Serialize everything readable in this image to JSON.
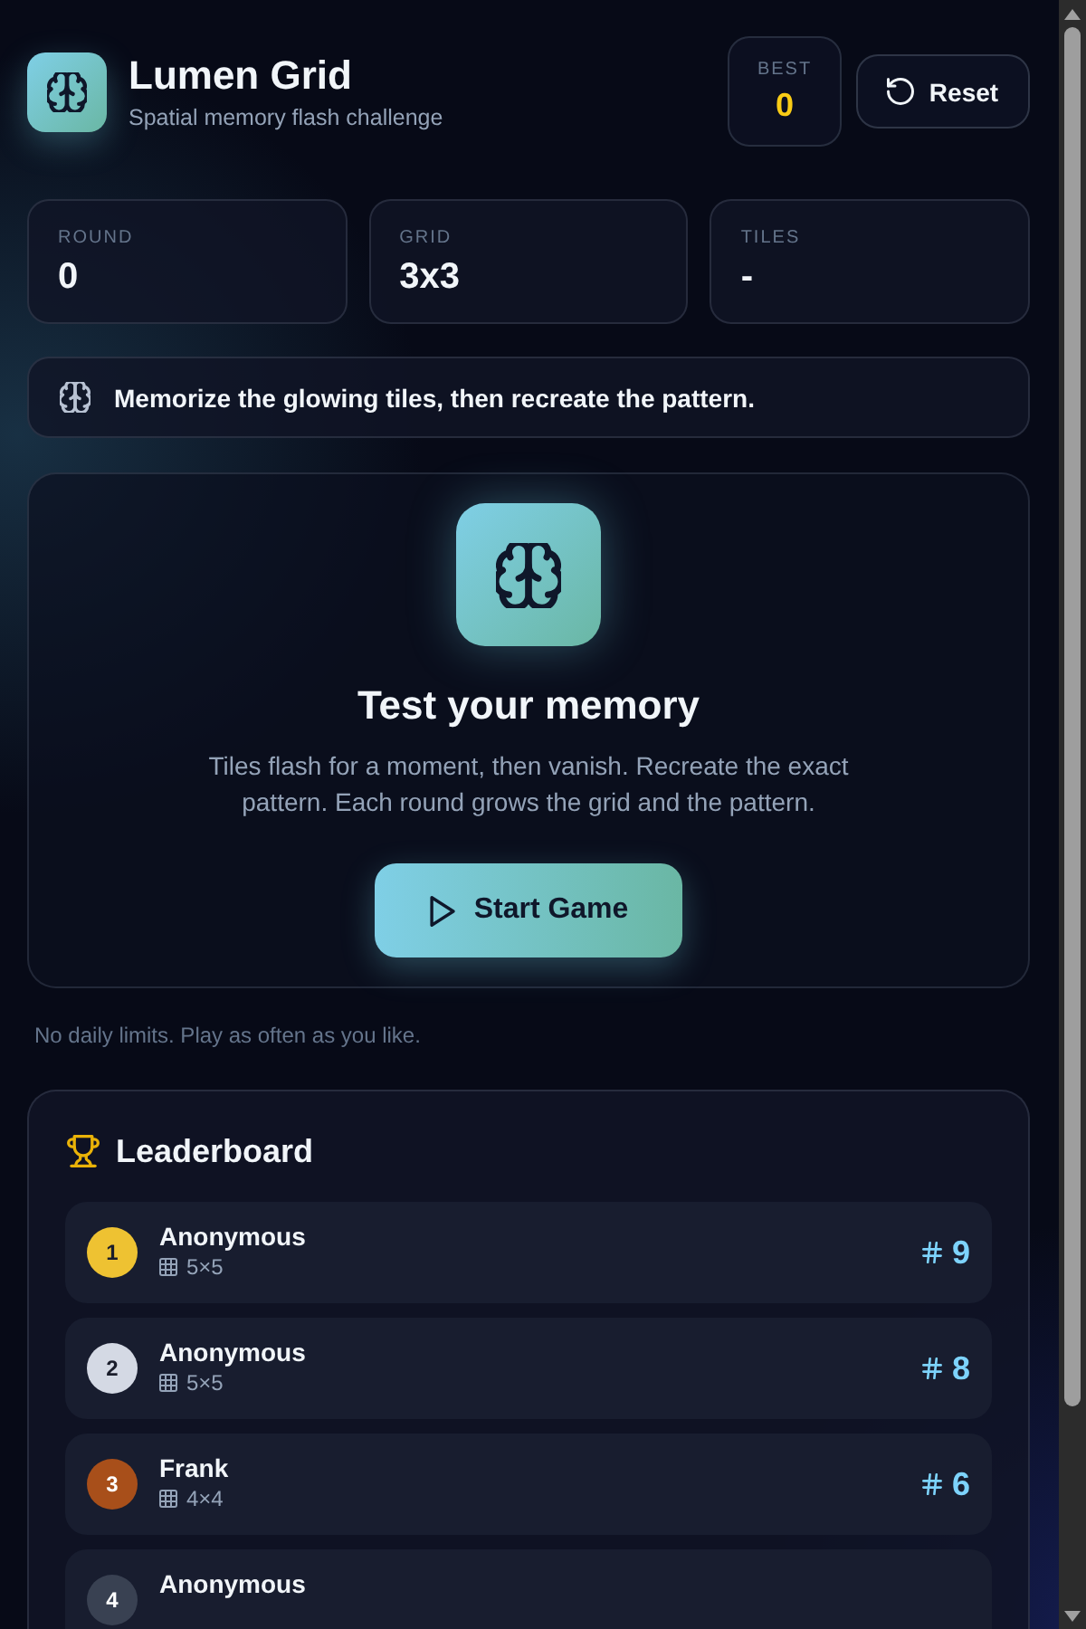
{
  "header": {
    "title": "Lumen Grid",
    "subtitle": "Spatial memory flash challenge",
    "best": {
      "label": "BEST",
      "value": "0"
    },
    "reset_button": "Reset"
  },
  "stats": [
    {
      "label": "ROUND",
      "value": "0"
    },
    {
      "label": "GRID",
      "value": "3x3"
    },
    {
      "label": "TILES",
      "value": "-"
    }
  ],
  "hint": "Memorize the glowing tiles, then recreate the pattern.",
  "intro": {
    "title": "Test your memory",
    "description": "Tiles flash for a moment, then vanish. Recreate the exact pattern. Each round grows the grid and the pattern.",
    "start_button": "Start Game"
  },
  "note": "No daily limits. Play as often as you like.",
  "leaderboard": {
    "title": "Leaderboard",
    "entries": [
      {
        "rank": "1",
        "color": "#eec232",
        "name": "Anonymous",
        "grid": "5×5",
        "score": "9"
      },
      {
        "rank": "2",
        "color": "#d4d9e4",
        "name": "Anonymous",
        "grid": "5×5",
        "score": "8"
      },
      {
        "rank": "3",
        "color": "#a84f1a",
        "name": "Frank",
        "grid": "4×4",
        "score": "6"
      },
      {
        "rank": "4",
        "color": "#394152",
        "name": "Anonymous"
      }
    ]
  }
}
